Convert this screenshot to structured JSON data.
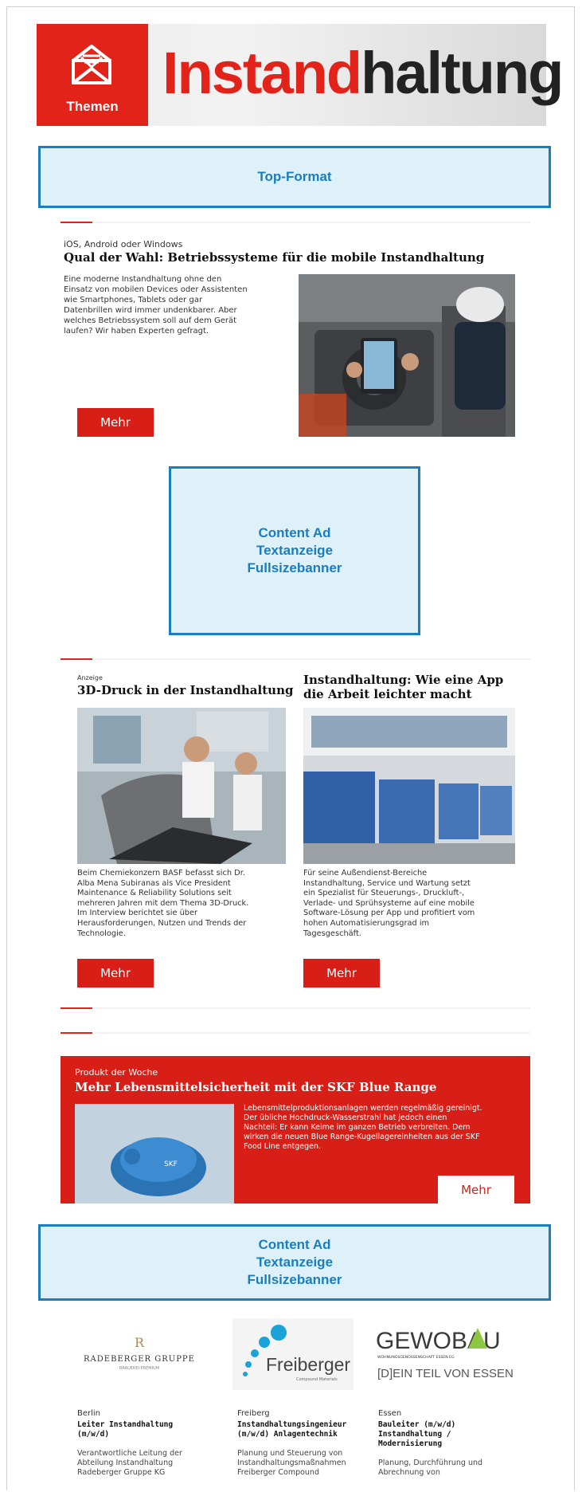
{
  "header": {
    "badge_label": "Themen",
    "title_part1": "Instand",
    "title_part2": "haltung"
  },
  "ads": {
    "top": [
      "Top-Format"
    ],
    "middle": [
      "Content Ad",
      "Textanzeige",
      "Fullsizebanner"
    ],
    "bottom": [
      "Content Ad",
      "Textanzeige",
      "Fullsizebanner"
    ]
  },
  "article_main": {
    "kicker": "iOS, Android oder Windows",
    "headline": "Qual der Wahl: Betriebssysteme für die mobile Instandhaltung",
    "body_lines": [
      "Eine moderne Instandhaltung ohne den",
      "Einsatz von mobilen Devices oder Assistenten",
      "wie Smartphones, Tablets oder gar",
      "Datenbrillen wird immer undenkbarer. Aber",
      "welches Betriebssystem soll auf dem Gerät",
      "laufen? Wir haben Experten gefragt."
    ],
    "button": "Mehr"
  },
  "article_left": {
    "kicker": "Anzeige",
    "headline": "3D-Druck in der Instandhaltung",
    "body_lines": [
      "Beim Chemiekonzern BASF befasst sich Dr.",
      "Alba Mena Subiranas als Vice President",
      "Maintenance & Reliability Solutions seit",
      "mehreren Jahren mit dem Thema 3D-Druck.",
      "Im Interview berichtet sie über",
      "Herausforderungen, Nutzen und Trends der",
      "Technologie."
    ],
    "button": "Mehr"
  },
  "article_right": {
    "headline_lines": [
      "Instandhaltung: Wie eine App",
      "die Arbeit leichter macht"
    ],
    "body_lines": [
      "Für seine Außendienst-Bereiche",
      "Instandhaltung, Service und Wartung setzt",
      "ein Spezialist für Steuerungs-, Druckluft-,",
      "Verlade- und Sprühsysteme auf eine mobile",
      "Software-Lösung per App und profitiert vom",
      "hohen Automatisierungsgrad im",
      "Tagesgeschäft."
    ],
    "button": "Mehr"
  },
  "product_of_week": {
    "label": "Produkt der Woche",
    "headline": "Mehr Lebensmittelsicherheit mit der SKF Blue Range",
    "body_lines": [
      "Lebensmittelproduktionsanlagen werden regelmäßig gereinigt.",
      "Der übliche Hochdruck-Wasserstrahl hat jedoch einen",
      "Nachteil: Er kann Keime im ganzen Betrieb verbreiten. Dem",
      "wirken die neuen Blue Range-Kugellagereinheiten aus der SKF",
      "Food Line entgegen."
    ],
    "product_label": "SKF",
    "button": "Mehr"
  },
  "jobs": [
    {
      "logo_name": "RADEBERGER GRUPPE",
      "logo_sub": "BRAUEREI PREMIUM",
      "city": "Berlin",
      "title_lines": [
        "Leiter Instandhaltung",
        "(m/w/d)"
      ],
      "desc_lines": [
        "Verantwortliche Leitung der",
        "Abteilung Instandhaltung",
        "Radeberger Gruppe KG"
      ]
    },
    {
      "logo_name": "Freiberger",
      "logo_sub": "Compound Materials",
      "city": "Freiberg",
      "title_lines": [
        "Instandhaltungsingenieur",
        "(m/w/d) Anlagentechnik"
      ],
      "desc_lines": [
        "Planung und Steuerung von",
        "Instandhaltungsmaßnahmen",
        "Freiberger Compound"
      ]
    },
    {
      "logo_name": "GEWOBAU",
      "logo_sub": "WOHNUNGSGENOSSENSCHAFT ESSEN EG",
      "logo_tagline": "[D]EIN TEIL VON ESSEN",
      "city": "Essen",
      "title_lines": [
        "Bauleiter (m/w/d)",
        "Instandhaltung /",
        "Modernisierung"
      ],
      "desc_lines": [
        "Planung, Durchführung und",
        "Abrechnung von"
      ]
    }
  ],
  "colors": {
    "brand_red": "#e2231a",
    "ad_blue": "#1a7dbf",
    "ad_fill": "#def1f9"
  }
}
